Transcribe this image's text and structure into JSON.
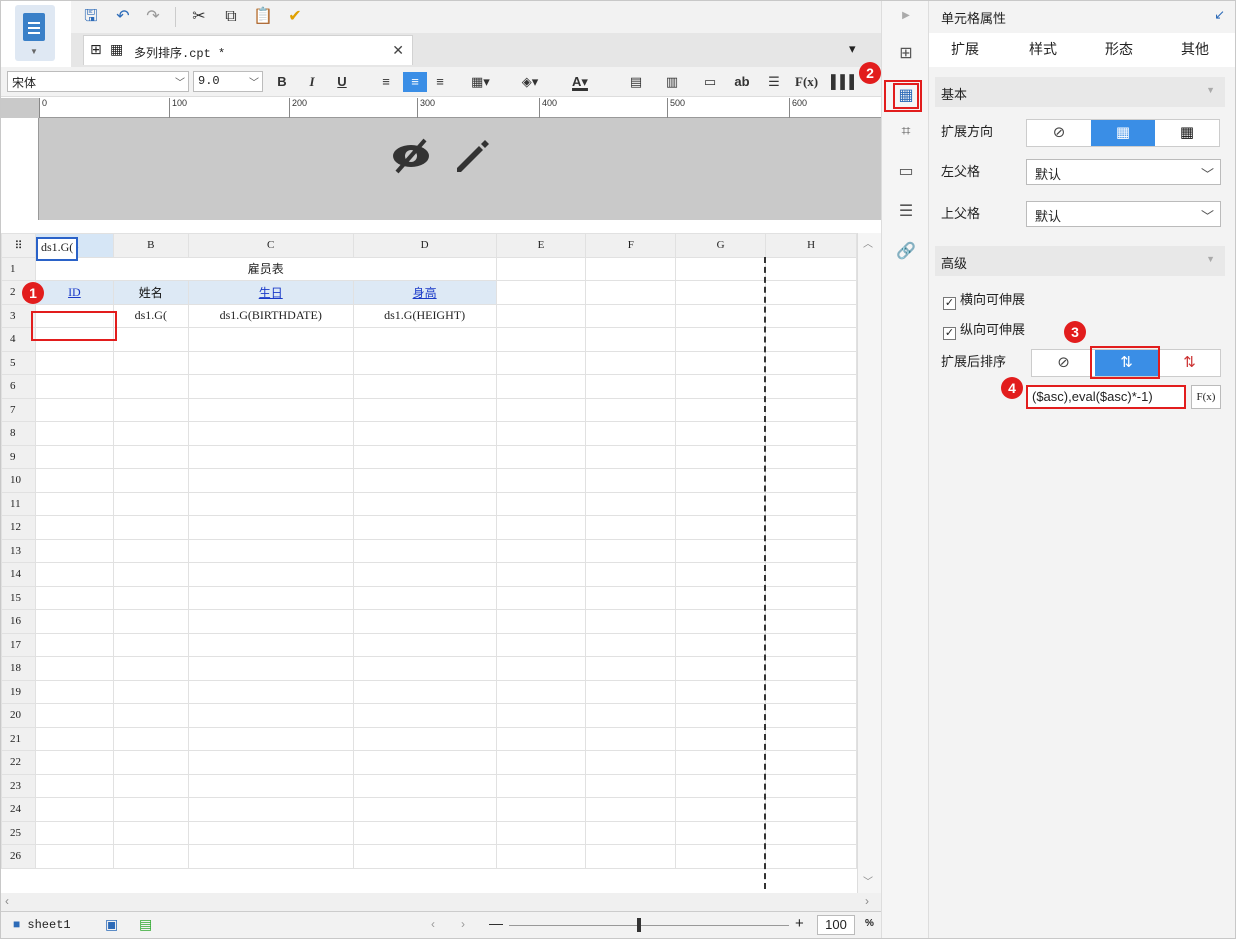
{
  "editor": {
    "tab_title": "多列排序.cpt *",
    "font_name": "宋体",
    "font_size": "9.0",
    "ruler_marks": [
      "0",
      "100",
      "200",
      "300",
      "400",
      "500",
      "600"
    ]
  },
  "grid": {
    "columns": [
      "A",
      "B",
      "C",
      "D",
      "E",
      "F",
      "G",
      "H"
    ],
    "title_cell": "雇员表",
    "headers": [
      "ID",
      "姓名",
      "生日",
      "身高"
    ],
    "row3": [
      "ds1.G(",
      "ds1.G(",
      "ds1.G(BIRTHDATE)",
      "ds1.G(HEIGHT)"
    ],
    "row_numbers": [
      "1",
      "2",
      "3",
      "4",
      "5",
      "6",
      "7",
      "8",
      "9",
      "10",
      "11",
      "12",
      "13",
      "14",
      "15",
      "16",
      "17",
      "18",
      "19",
      "20",
      "21",
      "22",
      "23",
      "24",
      "25",
      "26"
    ]
  },
  "status": {
    "sheet_name": "sheet1",
    "zoom": "100",
    "zoom_unit": "%"
  },
  "panel": {
    "title": "单元格属性",
    "tabs": [
      "扩展",
      "样式",
      "形态",
      "其他"
    ],
    "section_basic": "基本",
    "expand_direction_label": "扩展方向",
    "left_parent_label": "左父格",
    "left_parent_value": "默认",
    "top_parent_label": "上父格",
    "top_parent_value": "默认",
    "section_advanced": "高级",
    "horizontal_expand": "横向可伸展",
    "vertical_expand": "纵向可伸展",
    "sort_label": "扩展后排序",
    "sort_formula": "($asc),eval($asc)*-1)",
    "formula_button": "F(x)"
  },
  "badges": [
    "1",
    "2",
    "3",
    "4"
  ],
  "colors": {
    "accent": "#3a8ee6",
    "badge": "#e21d1d",
    "header_link": "#1a3ac8"
  }
}
